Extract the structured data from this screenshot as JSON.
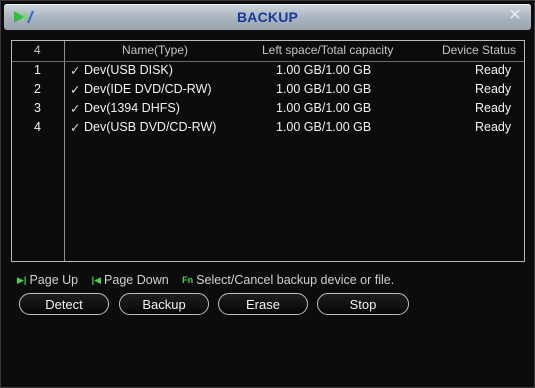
{
  "window": {
    "title": "BACKUP"
  },
  "icons": {
    "logo": "play-logo-icon",
    "close": "close-icon"
  },
  "table": {
    "headers": {
      "index": "4",
      "name": "Name(Type)",
      "space": "Left space/Total capacity",
      "status": "Device Status"
    },
    "rows": [
      {
        "index": "1",
        "checked": "✓",
        "name": "Dev(USB DISK)",
        "space": "1.00 GB/1.00 GB",
        "status": "Ready"
      },
      {
        "index": "2",
        "checked": "✓",
        "name": "Dev(IDE DVD/CD-RW)",
        "space": "1.00 GB/1.00 GB",
        "status": "Ready"
      },
      {
        "index": "3",
        "checked": "✓",
        "name": "Dev(1394 DHFS)",
        "space": "1.00 GB/1.00 GB",
        "status": "Ready"
      },
      {
        "index": "4",
        "checked": "✓",
        "name": "Dev(USB DVD/CD-RW)",
        "space": "1.00 GB/1.00 GB",
        "status": "Ready"
      }
    ]
  },
  "hints": {
    "page_up_key": "▶|",
    "page_up": "Page Up",
    "page_down_key": "|◀",
    "page_down": "Page Down",
    "fn_key": "Fn",
    "select": "Select/Cancel backup device or file."
  },
  "buttons": {
    "detect": "Detect",
    "backup": "Backup",
    "erase": "Erase",
    "stop": "Stop"
  },
  "colors": {
    "title_text": "#173a9a",
    "hint_icon": "#3fd64a",
    "background": "#0c0c0c"
  }
}
